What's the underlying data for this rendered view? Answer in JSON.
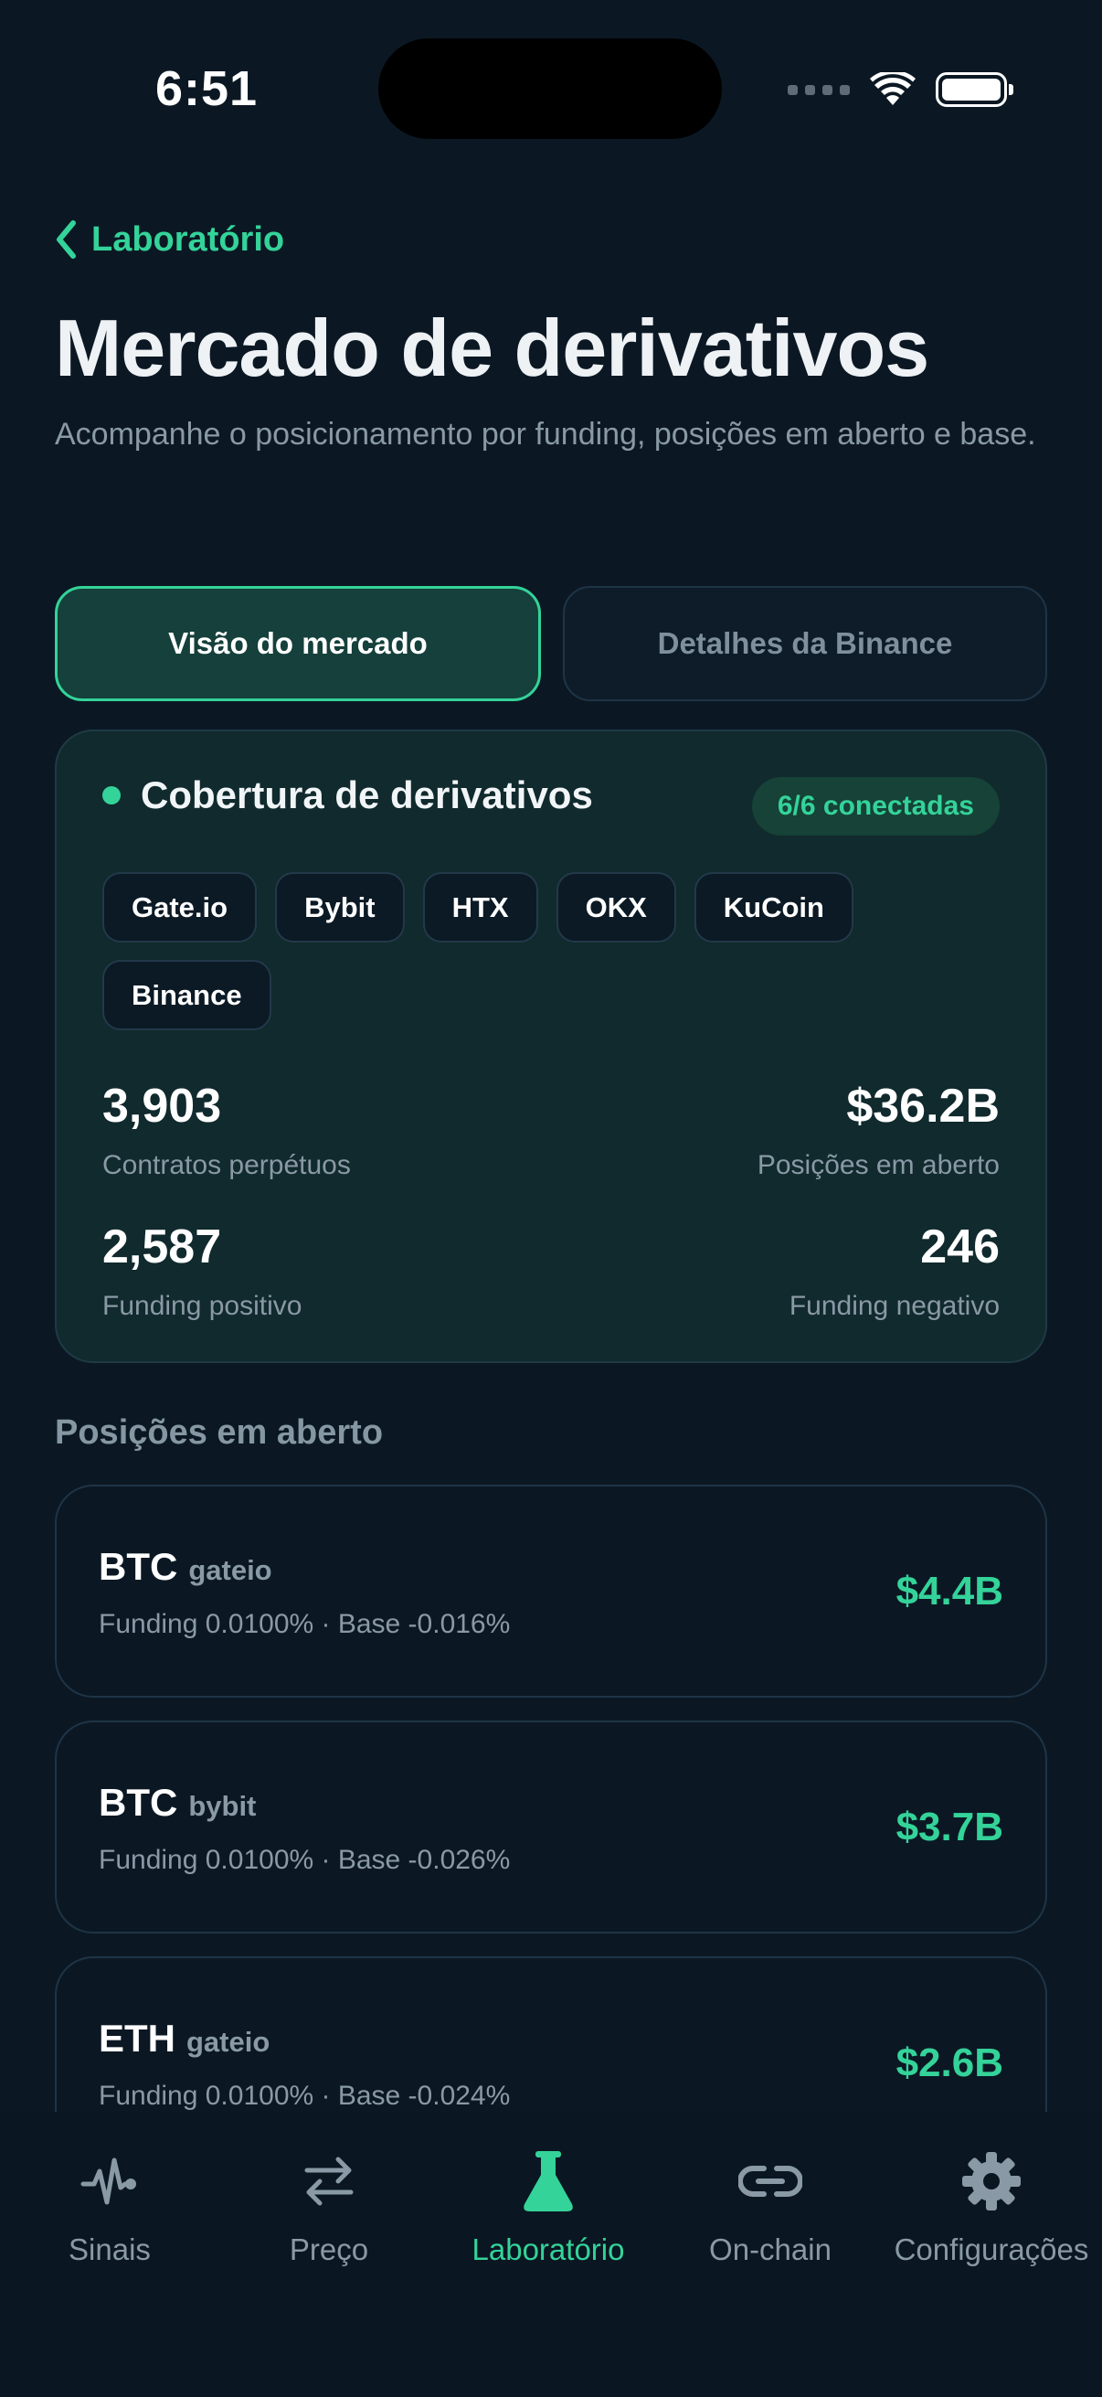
{
  "status_bar": {
    "time": "6:51"
  },
  "nav": {
    "back_label": "Laboratório"
  },
  "header": {
    "title": "Mercado de derivativos",
    "subtitle": "Acompanhe o posicionamento por funding, posições em aberto e base."
  },
  "tabs": [
    {
      "label": "Visão do mercado",
      "active": true
    },
    {
      "label": "Detalhes da Binance",
      "active": false
    }
  ],
  "coverage": {
    "title": "Cobertura de derivativos",
    "badge": "6/6 conectadas",
    "exchanges": [
      "Gate.io",
      "Bybit",
      "HTX",
      "OKX",
      "KuCoin",
      "Binance"
    ],
    "stats": {
      "perpetual_contracts": {
        "value": "3,903",
        "label": "Contratos perpétuos"
      },
      "open_interest": {
        "value": "$36.2B",
        "label": "Posições em aberto"
      },
      "positive_funding": {
        "value": "2,587",
        "label": "Funding positivo"
      },
      "negative_funding": {
        "value": "246",
        "label": "Funding negativo"
      }
    }
  },
  "open_positions": {
    "section_title": "Posições em aberto",
    "items": [
      {
        "symbol": "BTC",
        "exchange": "gateio",
        "meta": "Funding 0.0100% · Base -0.016%",
        "value": "$4.4B"
      },
      {
        "symbol": "BTC",
        "exchange": "bybit",
        "meta": "Funding 0.0100% · Base -0.026%",
        "value": "$3.7B"
      },
      {
        "symbol": "ETH",
        "exchange": "gateio",
        "meta": "Funding 0.0100% · Base -0.024%",
        "value": "$2.6B"
      }
    ]
  },
  "tabbar": {
    "items": [
      {
        "label": "Sinais",
        "icon": "pulse-icon",
        "active": false
      },
      {
        "label": "Preço",
        "icon": "swap-arrows-icon",
        "active": false
      },
      {
        "label": "Laboratório",
        "icon": "flask-icon",
        "active": true
      },
      {
        "label": "On-chain",
        "icon": "link-icon",
        "active": false
      },
      {
        "label": "Configurações",
        "icon": "gear-icon",
        "active": false
      }
    ]
  },
  "colors": {
    "background": "#0b1824",
    "accent": "#34d399",
    "card": "#102a2d",
    "muted_text": "#8a99a6"
  }
}
